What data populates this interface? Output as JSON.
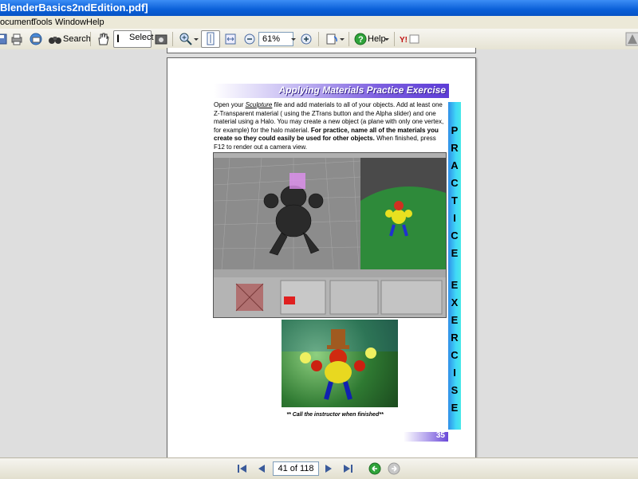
{
  "window": {
    "title": "BlenderBasics2ndEdition.pdf]"
  },
  "menu": {
    "items": [
      "ocument",
      "Tools",
      "Window",
      "Help"
    ]
  },
  "toolbar": {
    "search_label": "Search",
    "select_label": "Select",
    "zoom_value": "61%",
    "help_label": "Help"
  },
  "document": {
    "heading": "Applying Materials Practice Exercise",
    "body_prefix": "Open your ",
    "body_link": "Sculpture",
    "body_rest": " file and add materials to all of your objects. Add at least one Z-Transparent material ( using the ZTrans button and the Alpha slider) and one material using a Halo. You may create a new object (a plane with only one vertex, for example) for the halo material. ",
    "body_bold": "For practice, name all of the materials you create so they could easily be used for other objects.",
    "body_end": " When finished, press F12 to render out a camera view.",
    "sidebar_word1": [
      "P",
      "R",
      "A",
      "C",
      "T",
      "I",
      "C",
      "E"
    ],
    "sidebar_word2": [
      "E",
      "X",
      "E",
      "R",
      "C",
      "I",
      "S",
      "E"
    ],
    "caption": "** Call the instructor when finished**",
    "page_number": "35"
  },
  "navigation": {
    "page_indicator": "41 of 118"
  },
  "colors": {
    "titlebar": "#0a5fd8",
    "accent_purple": "#6a48d8",
    "accent_cyan": "#40d8f8"
  }
}
